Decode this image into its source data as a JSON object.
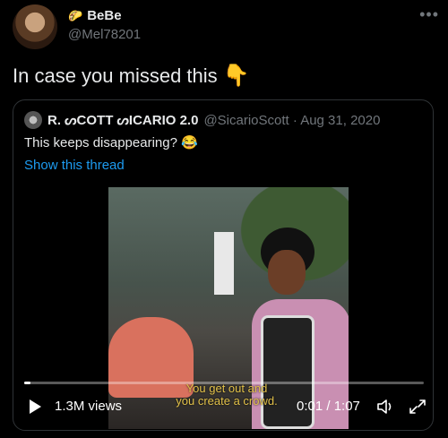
{
  "author": {
    "display_name": "BeBe",
    "handle": "@Mel78201",
    "name_icon": "taco-icon"
  },
  "tweet": {
    "text": "In case you missed this",
    "emoji": "👇"
  },
  "quoted": {
    "display_name": "R. ᔕCOTT ᔕICARIO 2.0",
    "meta": "@SicarioScott · Aug 31, 2020",
    "text": "This keeps disappearing?",
    "emoji": "😂",
    "link": "Show this thread"
  },
  "video": {
    "caption_line1": "You get out and",
    "caption_line2": "you create a crowd.",
    "views": "1.3M views",
    "timecode": "0:01 / 1:07",
    "progress": 0.015
  },
  "colors": {
    "background": "#000000",
    "text": "#e7e9ea",
    "secondary": "#71767b",
    "link": "#1d9bf0",
    "caption": "#e2c14a"
  }
}
